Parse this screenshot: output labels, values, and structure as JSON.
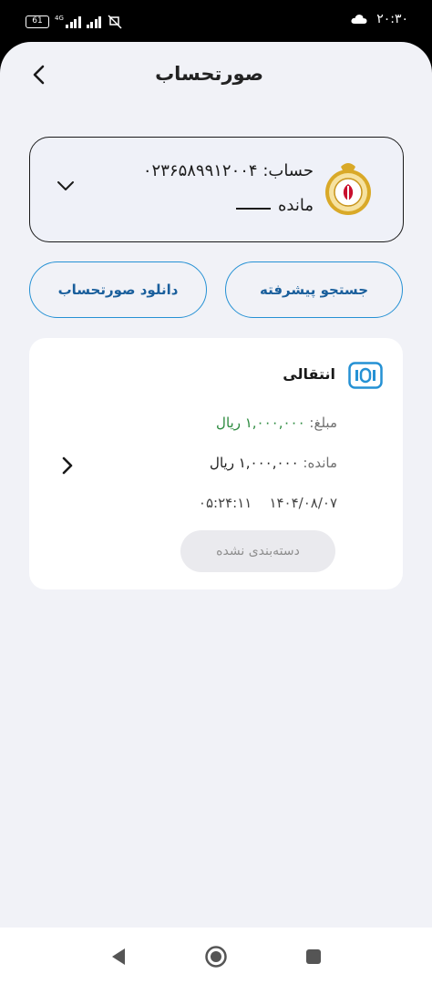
{
  "status_bar": {
    "battery": "61",
    "network": "4G",
    "time": "۲۰:۳۰",
    "icons": [
      "battery-icon",
      "signal-icon",
      "wifi-icon",
      "mute-icon",
      "cloud-icon"
    ]
  },
  "header": {
    "title": "صورتحساب",
    "back_icon": "chevron-left-icon"
  },
  "account": {
    "label": "حساب:",
    "number": "۰۲۳۶۵۸۹۹۱۲۰۰۴",
    "balance_label": "مانده",
    "balance_value": "",
    "logo_icon": "bank-melli-logo",
    "dropdown_icon": "chevron-down-icon"
  },
  "actions": {
    "advanced_search": "جستجو پیشرفته",
    "download_statement": "دانلود صورتحساب"
  },
  "transactions": [
    {
      "type": "انتقالی",
      "type_icon": "transfer-151-icon",
      "amount_label": "مبلغ:",
      "amount": "۱,۰۰۰,۰۰۰ ریال",
      "balance_label": "مانده:",
      "balance": "۱,۰۰۰,۰۰۰ ریال",
      "date": "۱۴۰۴/۰۸/۰۷",
      "time": "۰۵:۲۴:۱۱",
      "category": "دسته‌بندی نشده"
    }
  ],
  "colors": {
    "accent": "#2591d4",
    "amount_green": "#2b8a3e",
    "background": "#f1f2f7",
    "card": "#ffffff"
  },
  "nav": {
    "icons": [
      "nav-back-icon",
      "nav-home-icon",
      "nav-recents-icon"
    ]
  }
}
